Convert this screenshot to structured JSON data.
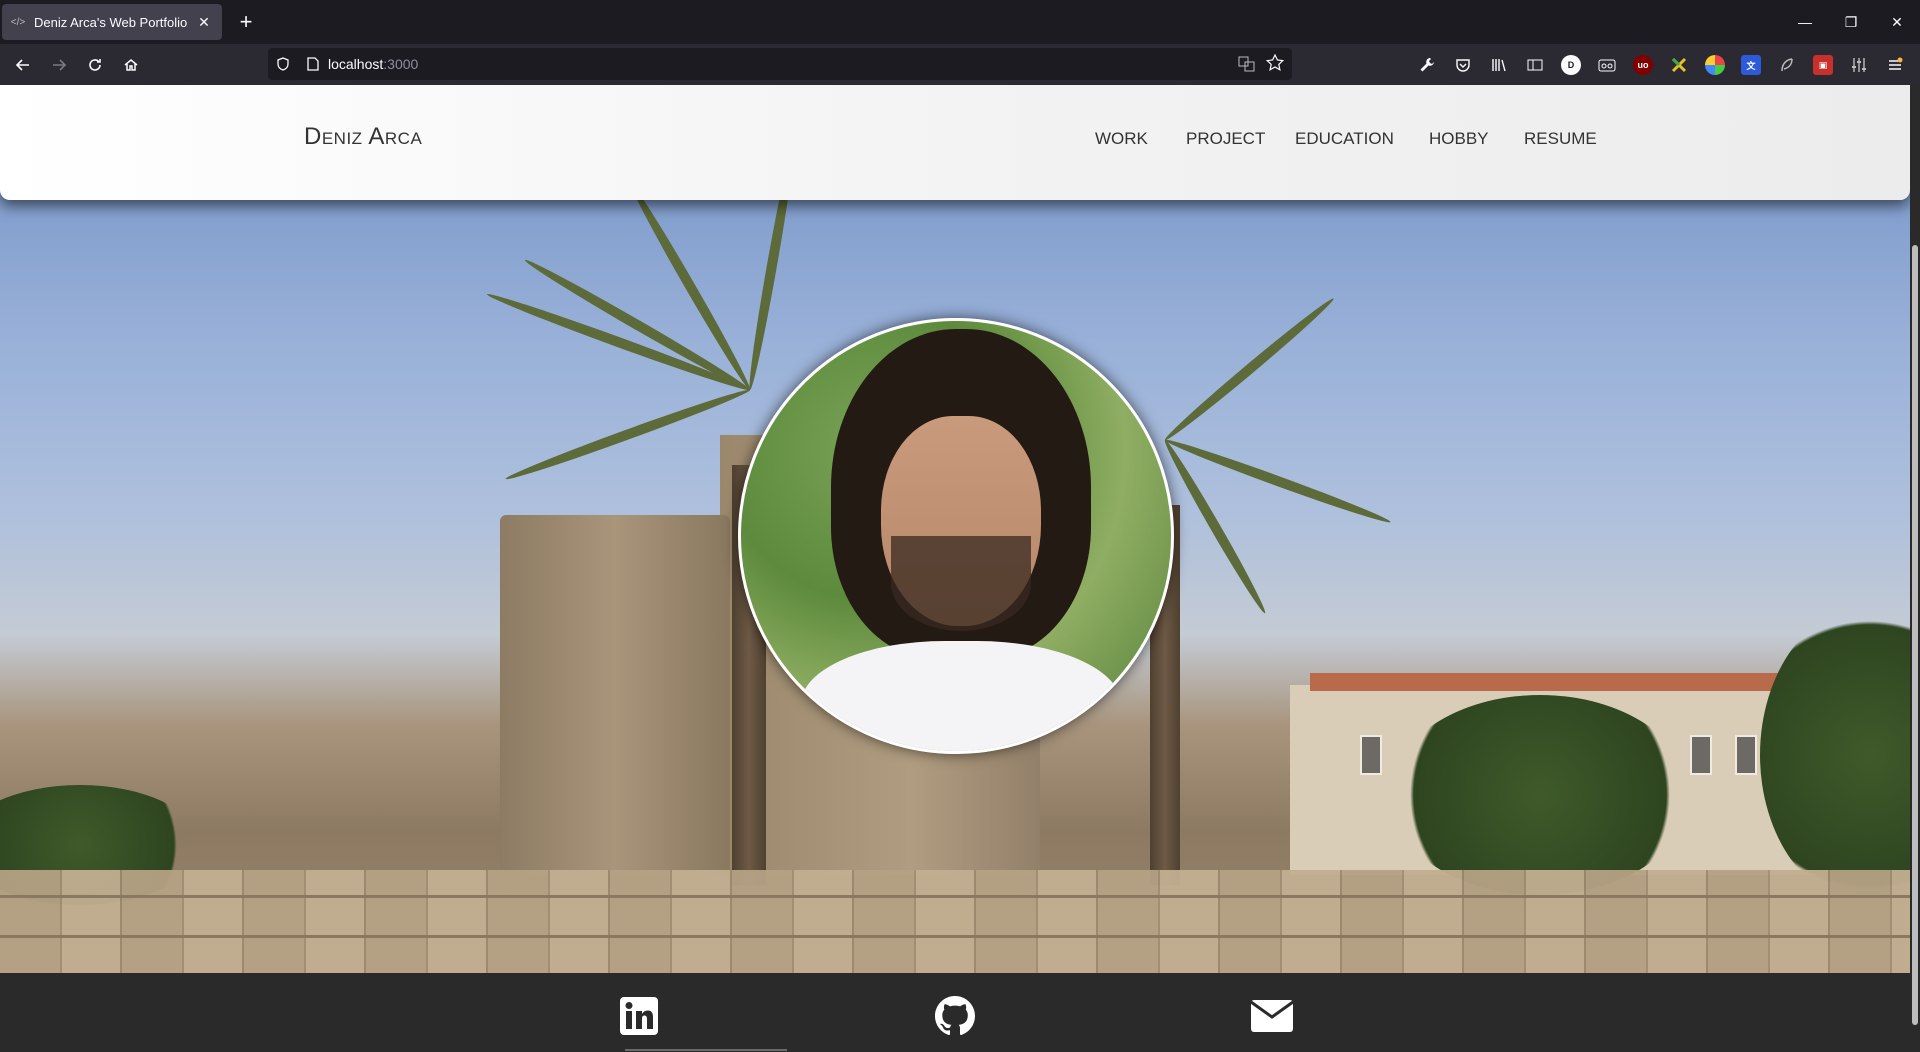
{
  "browser": {
    "tab_title": "Deniz Arca's Web Portfolio",
    "url_host": "localhost",
    "url_port": ":3000"
  },
  "site": {
    "brand": "Deniz Arca",
    "nav": [
      {
        "label": "WORK"
      },
      {
        "label": "PROJECT"
      },
      {
        "label": "EDUCATION"
      },
      {
        "label": "HOBBY"
      },
      {
        "label": "RESUME"
      }
    ]
  },
  "footer": {
    "links": [
      {
        "icon": "linkedin-icon"
      },
      {
        "icon": "github-icon"
      },
      {
        "icon": "envelope-icon"
      }
    ]
  },
  "colors": {
    "chrome_dark": "#1c1b22",
    "toolbar": "#2b2a33",
    "footer_bg": "#2a2a2a",
    "header_bg": "#f3f3f3",
    "nav_text": "#333333"
  }
}
